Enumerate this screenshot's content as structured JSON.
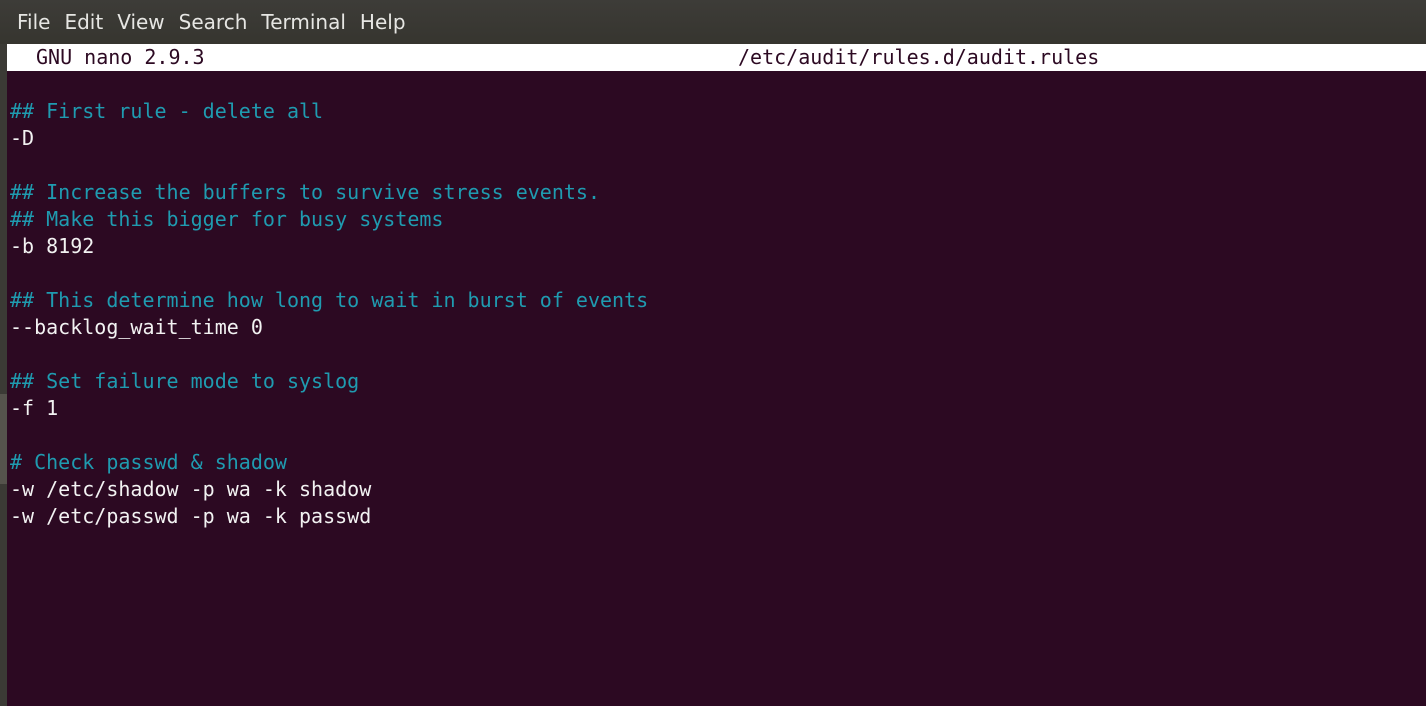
{
  "menubar": {
    "items": [
      "File",
      "Edit",
      "View",
      "Search",
      "Terminal",
      "Help"
    ]
  },
  "nano": {
    "version": "GNU nano 2.9.3",
    "filename": "/etc/audit/rules.d/audit.rules"
  },
  "editor": {
    "lines": [
      {
        "type": "comment",
        "text": "## First rule - delete all"
      },
      {
        "type": "code",
        "text": "-D"
      },
      {
        "type": "blank",
        "text": ""
      },
      {
        "type": "comment",
        "text": "## Increase the buffers to survive stress events."
      },
      {
        "type": "comment",
        "text": "## Make this bigger for busy systems"
      },
      {
        "type": "code",
        "text": "-b 8192"
      },
      {
        "type": "blank",
        "text": ""
      },
      {
        "type": "comment",
        "text": "## This determine how long to wait in burst of events"
      },
      {
        "type": "code",
        "text": "--backlog_wait_time 0"
      },
      {
        "type": "blank",
        "text": ""
      },
      {
        "type": "comment",
        "text": "## Set failure mode to syslog"
      },
      {
        "type": "code",
        "text": "-f 1"
      },
      {
        "type": "blank",
        "text": ""
      },
      {
        "type": "comment",
        "text": "# Check passwd & shadow"
      },
      {
        "type": "code",
        "text": "-w /etc/shadow -p wa -k shadow"
      },
      {
        "type": "code",
        "text": "-w /etc/passwd -p wa -k passwd"
      }
    ]
  },
  "colors": {
    "background": "#2c0922",
    "comment": "#1f9bb0",
    "text": "#f2f2f2",
    "menubar": "#3a3934"
  }
}
